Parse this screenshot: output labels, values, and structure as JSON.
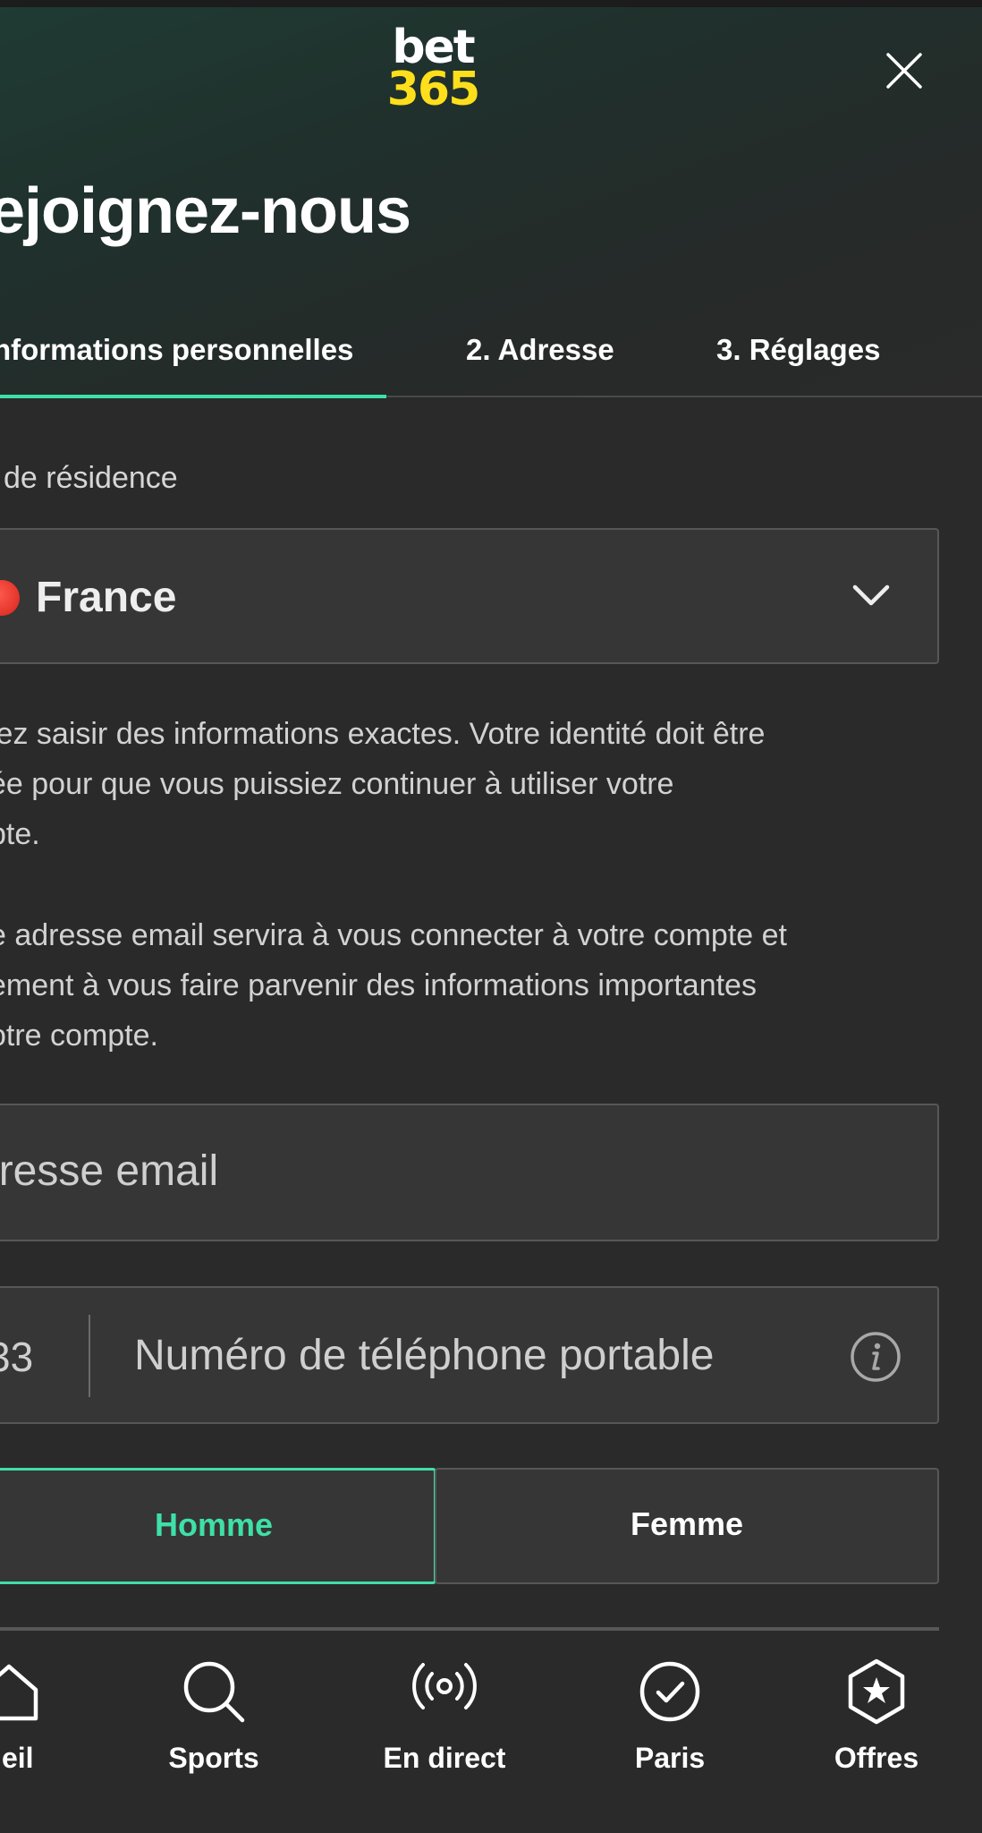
{
  "brand": {
    "logo_line1": "bet",
    "logo_line2": "365",
    "logo_accent": "#ffdf1b"
  },
  "header": {
    "title": "ejoignez-nous",
    "close_icon": "close-icon"
  },
  "tabs": [
    {
      "label": "nformations personnelles",
      "active": true
    },
    {
      "label": "2.  Adresse",
      "active": false
    },
    {
      "label": "3.  Réglages",
      "active": false
    }
  ],
  "form": {
    "residence_label": " de résidence",
    "country_value": "France",
    "info_text_1": "lez saisir des informations exactes. Votre identité doit être\née pour que vous puissiez continuer à utiliser votre\npte.",
    "info_text_2": "e adresse email servira à vous connecter à votre compte et\nement à vous faire parvenir des informations importantes\notre compte.",
    "email_placeholder": "dresse email",
    "phone_prefix": "33",
    "phone_placeholder": "Numéro de téléphone portable",
    "gender_options": [
      "Homme",
      "Femme"
    ],
    "gender_selected": "Homme"
  },
  "bottom_nav": [
    {
      "label": "ueil",
      "icon": "home-icon"
    },
    {
      "label": "Sports",
      "icon": "search-icon"
    },
    {
      "label": "En direct",
      "icon": "live-broadcast-icon"
    },
    {
      "label": "Paris",
      "icon": "check-circle-icon"
    },
    {
      "label": "Offres",
      "icon": "star-badge-icon"
    }
  ],
  "colors": {
    "accent": "#3ee0a8",
    "background": "#2a2a2a",
    "field": "#363636"
  }
}
